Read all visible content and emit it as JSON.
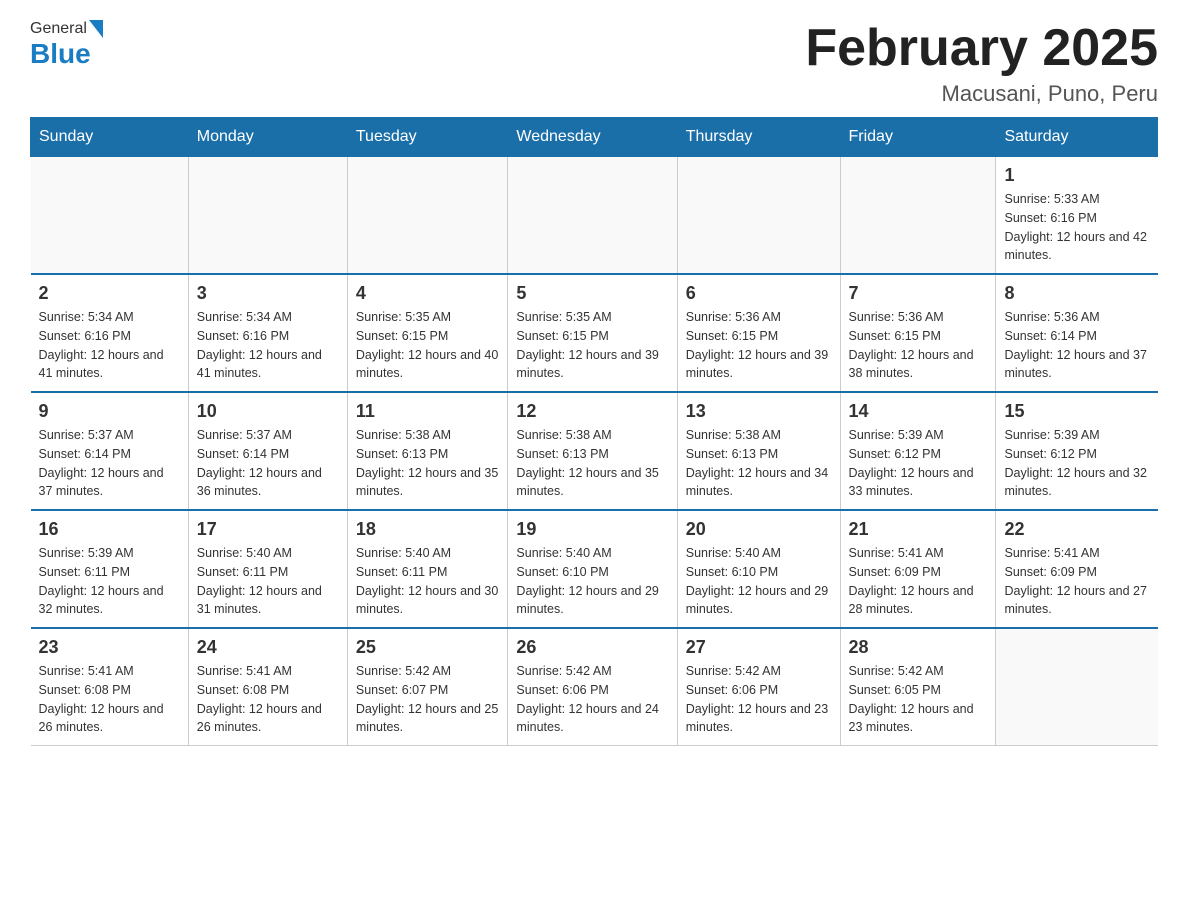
{
  "header": {
    "logo_general": "General",
    "logo_blue": "Blue",
    "month_title": "February 2025",
    "location": "Macusani, Puno, Peru"
  },
  "days_of_week": [
    "Sunday",
    "Monday",
    "Tuesday",
    "Wednesday",
    "Thursday",
    "Friday",
    "Saturday"
  ],
  "weeks": [
    [
      {
        "day": "",
        "sunrise": "",
        "sunset": "",
        "daylight": "",
        "empty": true
      },
      {
        "day": "",
        "sunrise": "",
        "sunset": "",
        "daylight": "",
        "empty": true
      },
      {
        "day": "",
        "sunrise": "",
        "sunset": "",
        "daylight": "",
        "empty": true
      },
      {
        "day": "",
        "sunrise": "",
        "sunset": "",
        "daylight": "",
        "empty": true
      },
      {
        "day": "",
        "sunrise": "",
        "sunset": "",
        "daylight": "",
        "empty": true
      },
      {
        "day": "",
        "sunrise": "",
        "sunset": "",
        "daylight": "",
        "empty": true
      },
      {
        "day": "1",
        "sunrise": "Sunrise: 5:33 AM",
        "sunset": "Sunset: 6:16 PM",
        "daylight": "Daylight: 12 hours and 42 minutes.",
        "empty": false
      }
    ],
    [
      {
        "day": "2",
        "sunrise": "Sunrise: 5:34 AM",
        "sunset": "Sunset: 6:16 PM",
        "daylight": "Daylight: 12 hours and 41 minutes.",
        "empty": false
      },
      {
        "day": "3",
        "sunrise": "Sunrise: 5:34 AM",
        "sunset": "Sunset: 6:16 PM",
        "daylight": "Daylight: 12 hours and 41 minutes.",
        "empty": false
      },
      {
        "day": "4",
        "sunrise": "Sunrise: 5:35 AM",
        "sunset": "Sunset: 6:15 PM",
        "daylight": "Daylight: 12 hours and 40 minutes.",
        "empty": false
      },
      {
        "day": "5",
        "sunrise": "Sunrise: 5:35 AM",
        "sunset": "Sunset: 6:15 PM",
        "daylight": "Daylight: 12 hours and 39 minutes.",
        "empty": false
      },
      {
        "day": "6",
        "sunrise": "Sunrise: 5:36 AM",
        "sunset": "Sunset: 6:15 PM",
        "daylight": "Daylight: 12 hours and 39 minutes.",
        "empty": false
      },
      {
        "day": "7",
        "sunrise": "Sunrise: 5:36 AM",
        "sunset": "Sunset: 6:15 PM",
        "daylight": "Daylight: 12 hours and 38 minutes.",
        "empty": false
      },
      {
        "day": "8",
        "sunrise": "Sunrise: 5:36 AM",
        "sunset": "Sunset: 6:14 PM",
        "daylight": "Daylight: 12 hours and 37 minutes.",
        "empty": false
      }
    ],
    [
      {
        "day": "9",
        "sunrise": "Sunrise: 5:37 AM",
        "sunset": "Sunset: 6:14 PM",
        "daylight": "Daylight: 12 hours and 37 minutes.",
        "empty": false
      },
      {
        "day": "10",
        "sunrise": "Sunrise: 5:37 AM",
        "sunset": "Sunset: 6:14 PM",
        "daylight": "Daylight: 12 hours and 36 minutes.",
        "empty": false
      },
      {
        "day": "11",
        "sunrise": "Sunrise: 5:38 AM",
        "sunset": "Sunset: 6:13 PM",
        "daylight": "Daylight: 12 hours and 35 minutes.",
        "empty": false
      },
      {
        "day": "12",
        "sunrise": "Sunrise: 5:38 AM",
        "sunset": "Sunset: 6:13 PM",
        "daylight": "Daylight: 12 hours and 35 minutes.",
        "empty": false
      },
      {
        "day": "13",
        "sunrise": "Sunrise: 5:38 AM",
        "sunset": "Sunset: 6:13 PM",
        "daylight": "Daylight: 12 hours and 34 minutes.",
        "empty": false
      },
      {
        "day": "14",
        "sunrise": "Sunrise: 5:39 AM",
        "sunset": "Sunset: 6:12 PM",
        "daylight": "Daylight: 12 hours and 33 minutes.",
        "empty": false
      },
      {
        "day": "15",
        "sunrise": "Sunrise: 5:39 AM",
        "sunset": "Sunset: 6:12 PM",
        "daylight": "Daylight: 12 hours and 32 minutes.",
        "empty": false
      }
    ],
    [
      {
        "day": "16",
        "sunrise": "Sunrise: 5:39 AM",
        "sunset": "Sunset: 6:11 PM",
        "daylight": "Daylight: 12 hours and 32 minutes.",
        "empty": false
      },
      {
        "day": "17",
        "sunrise": "Sunrise: 5:40 AM",
        "sunset": "Sunset: 6:11 PM",
        "daylight": "Daylight: 12 hours and 31 minutes.",
        "empty": false
      },
      {
        "day": "18",
        "sunrise": "Sunrise: 5:40 AM",
        "sunset": "Sunset: 6:11 PM",
        "daylight": "Daylight: 12 hours and 30 minutes.",
        "empty": false
      },
      {
        "day": "19",
        "sunrise": "Sunrise: 5:40 AM",
        "sunset": "Sunset: 6:10 PM",
        "daylight": "Daylight: 12 hours and 29 minutes.",
        "empty": false
      },
      {
        "day": "20",
        "sunrise": "Sunrise: 5:40 AM",
        "sunset": "Sunset: 6:10 PM",
        "daylight": "Daylight: 12 hours and 29 minutes.",
        "empty": false
      },
      {
        "day": "21",
        "sunrise": "Sunrise: 5:41 AM",
        "sunset": "Sunset: 6:09 PM",
        "daylight": "Daylight: 12 hours and 28 minutes.",
        "empty": false
      },
      {
        "day": "22",
        "sunrise": "Sunrise: 5:41 AM",
        "sunset": "Sunset: 6:09 PM",
        "daylight": "Daylight: 12 hours and 27 minutes.",
        "empty": false
      }
    ],
    [
      {
        "day": "23",
        "sunrise": "Sunrise: 5:41 AM",
        "sunset": "Sunset: 6:08 PM",
        "daylight": "Daylight: 12 hours and 26 minutes.",
        "empty": false
      },
      {
        "day": "24",
        "sunrise": "Sunrise: 5:41 AM",
        "sunset": "Sunset: 6:08 PM",
        "daylight": "Daylight: 12 hours and 26 minutes.",
        "empty": false
      },
      {
        "day": "25",
        "sunrise": "Sunrise: 5:42 AM",
        "sunset": "Sunset: 6:07 PM",
        "daylight": "Daylight: 12 hours and 25 minutes.",
        "empty": false
      },
      {
        "day": "26",
        "sunrise": "Sunrise: 5:42 AM",
        "sunset": "Sunset: 6:06 PM",
        "daylight": "Daylight: 12 hours and 24 minutes.",
        "empty": false
      },
      {
        "day": "27",
        "sunrise": "Sunrise: 5:42 AM",
        "sunset": "Sunset: 6:06 PM",
        "daylight": "Daylight: 12 hours and 23 minutes.",
        "empty": false
      },
      {
        "day": "28",
        "sunrise": "Sunrise: 5:42 AM",
        "sunset": "Sunset: 6:05 PM",
        "daylight": "Daylight: 12 hours and 23 minutes.",
        "empty": false
      },
      {
        "day": "",
        "sunrise": "",
        "sunset": "",
        "daylight": "",
        "empty": true
      }
    ]
  ]
}
